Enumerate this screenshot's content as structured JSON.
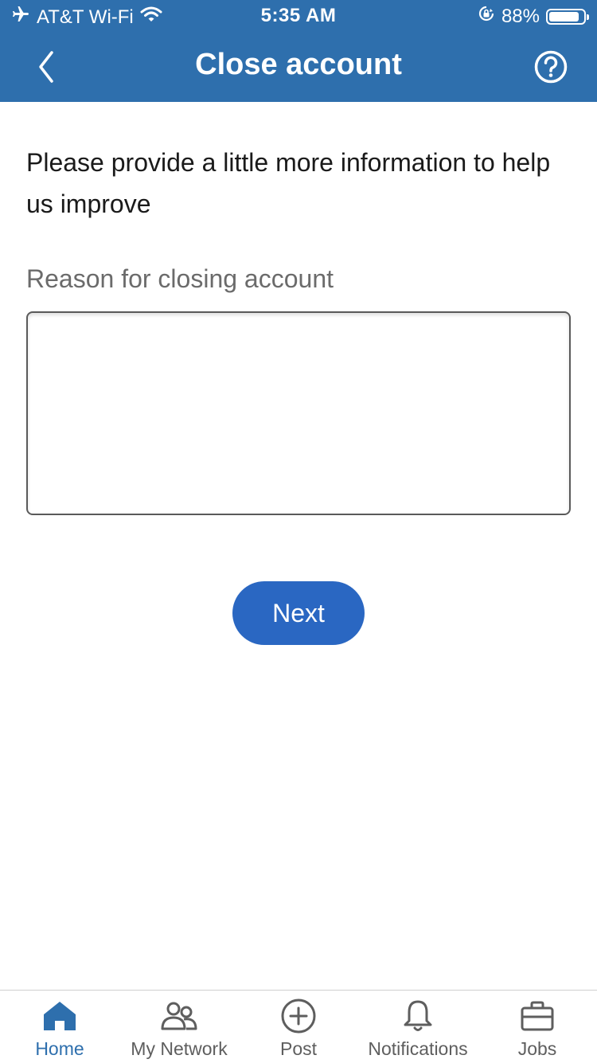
{
  "status_bar": {
    "carrier": "AT&T Wi-Fi",
    "time": "5:35 AM",
    "battery_text": "88%",
    "battery_level": 0.88,
    "icons": [
      "airplane-icon",
      "wifi-icon",
      "orientation-lock-icon",
      "battery-icon"
    ]
  },
  "header": {
    "title": "Close account",
    "back_icon": "chevron-left-icon",
    "help_icon": "question-circle-icon",
    "background": "#2e6fad"
  },
  "main": {
    "intro": "Please provide a little more information to help us improve",
    "reason_label": "Reason for closing account",
    "reason_value": "",
    "next_label": "Next",
    "button_color": "#2a67c2"
  },
  "tabbar": {
    "active_color": "#2e6fad",
    "items": [
      {
        "label": "Home",
        "icon": "home-icon",
        "active": true
      },
      {
        "label": "My Network",
        "icon": "people-icon",
        "active": false
      },
      {
        "label": "Post",
        "icon": "plus-circle-icon",
        "active": false
      },
      {
        "label": "Notifications",
        "icon": "bell-icon",
        "active": false
      },
      {
        "label": "Jobs",
        "icon": "briefcase-icon",
        "active": false
      }
    ]
  }
}
